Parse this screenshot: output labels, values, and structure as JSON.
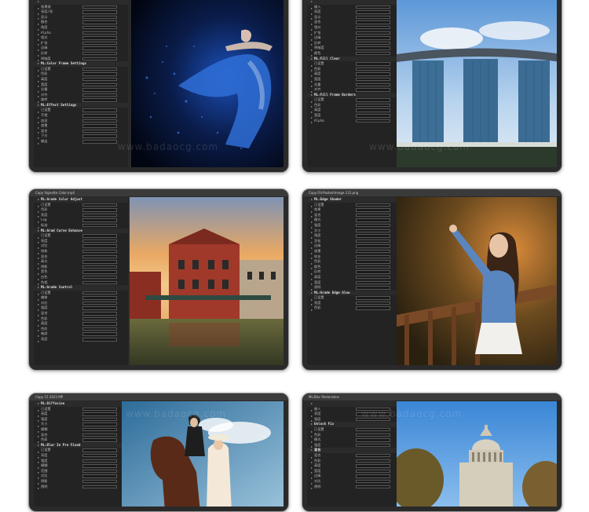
{
  "watermark_text": "www.badaocg.com",
  "cards": [
    {
      "id": "dancer",
      "title": "",
      "sections": [
        {
          "head": "",
          "rows": [
            "效果源",
            "亮度/亮",
            "显示",
            "融合",
            "角度",
            "Alpha",
            "相对",
            "扩张",
            "边缘",
            "反转",
            "明暗度"
          ]
        },
        {
          "head": "ML:Color Frame Settings",
          "rows": [
            "已设置",
            "色彩",
            "高度",
            "宽度",
            "总量",
            "对齐",
            "旋转"
          ]
        },
        {
          "head": "ML:Effect Settings",
          "rows": [
            "已设置",
            "不透",
            "加深",
            "遮罩",
            "混合",
            "下方",
            "输出"
          ]
        }
      ],
      "photo_caption": ""
    },
    {
      "id": "singapore",
      "title": "",
      "sections": [
        {
          "head": "",
          "rows": [
            "输入",
            "亮度",
            "显示",
            "混合",
            "相对",
            "扩张",
            "边缘",
            "反转",
            "明暗度",
            "颜色"
          ]
        },
        {
          "head": "ML:Fill Clear",
          "rows": [
            "已设置",
            "色彩",
            "高度",
            "宽度",
            "总量",
            "对齐"
          ]
        },
        {
          "head": "ML:Fill Frame Borders",
          "rows": [
            "已设置",
            "色彩",
            "高度",
            "宽度",
            "Alpha"
          ]
        }
      ]
    },
    {
      "id": "redbrick",
      "title": "Copy Vignette Color.mp4",
      "sections": [
        {
          "head": "ML:Grade Color Adjust",
          "rows": [
            "已设置",
            "色彩",
            "亮度",
            "Log",
            "标准"
          ]
        },
        {
          "head": "ML:Grad Curve Enhance",
          "rows": [
            "已设置",
            "亮度",
            "对比",
            "饱和",
            "混合",
            "高光",
            "阴影",
            "黑色",
            "白色",
            "色相"
          ]
        },
        {
          "head": "ML:Grade Control",
          "rows": [
            "已设置",
            "偏移",
            "对比",
            "强度",
            "混合",
            "色彩",
            "高度",
            "色阶",
            "暗部",
            "亮度"
          ]
        }
      ]
    },
    {
      "id": "woman-railing",
      "title": "Copy Fill-Pasted-Image 131.png",
      "sections": [
        {
          "head": "ML:Edge Shader",
          "rows": [
            "已设置",
            "效果",
            "混合",
            "模式",
            "强度",
            "大小",
            "角度",
            "羽化",
            "边缘",
            "遮罩",
            "软化",
            "色彩",
            "颜色",
            "反转",
            "高度",
            "宽度",
            "透明"
          ]
        },
        {
          "head": "ML:Grade Edge Glow",
          "rows": [
            "已设置",
            "亮度",
            "色彩"
          ]
        }
      ]
    },
    {
      "id": "horse",
      "title": "Copy 15 2023 MP",
      "sections": [
        {
          "head": "ML:Diffusion",
          "rows": [
            "已设置",
            "亮度",
            "强度",
            "大小",
            "模糊",
            "混合",
            "色彩"
          ]
        },
        {
          "head": "ML:Blur In Pre Fixed",
          "rows": [
            "已设置",
            "亮度",
            "强度",
            "模糊",
            "范围",
            "对比",
            "阴影",
            "透明"
          ]
        }
      ]
    },
    {
      "id": "dome",
      "title": "ML:Blur Restoration",
      "sections": [
        {
          "head": "",
          "rows": [
            "输入",
            "亮度",
            "强度"
          ]
        },
        {
          "head": "Unlock Fix",
          "rows": [
            "已设置",
            "色彩",
            "模式",
            "强度"
          ]
        },
        {
          "head": "混合",
          "rows": [
            "混合",
            "色彩",
            "高度",
            "宽度",
            "边缘",
            "对比",
            "透明"
          ]
        }
      ]
    }
  ]
}
